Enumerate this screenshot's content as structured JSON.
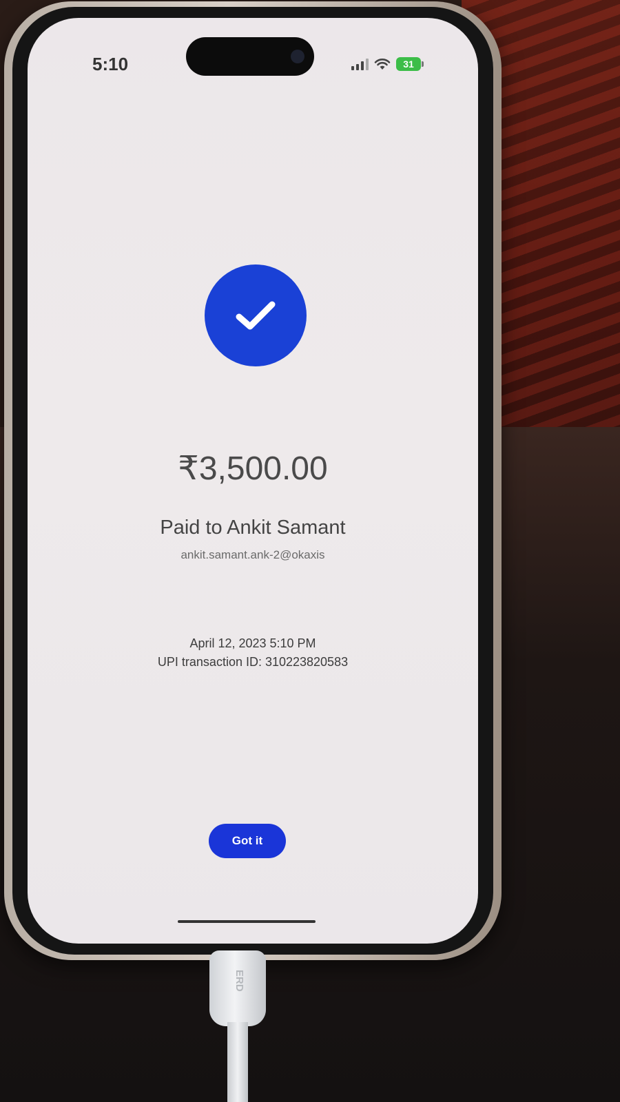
{
  "status_bar": {
    "time": "5:10",
    "battery": "31"
  },
  "payment": {
    "amount": "₹3,500.00",
    "paid_to": "Paid to Ankit Samant",
    "upi_id": "ankit.samant.ank-2@okaxis",
    "datetime": "April 12, 2023 5:10 PM",
    "transaction_id": "UPI transaction ID: 310223820583"
  },
  "actions": {
    "got_it_label": "Got it"
  },
  "cable": {
    "brand": "ERD"
  },
  "icons": {
    "success": "check-icon",
    "signal": "signal-icon",
    "wifi": "wifi-icon",
    "battery": "battery-icon"
  },
  "colors": {
    "accent": "#1a41d6",
    "button": "#1a35d8",
    "battery": "#3cbd48",
    "screen_background": "#ece7ea"
  }
}
